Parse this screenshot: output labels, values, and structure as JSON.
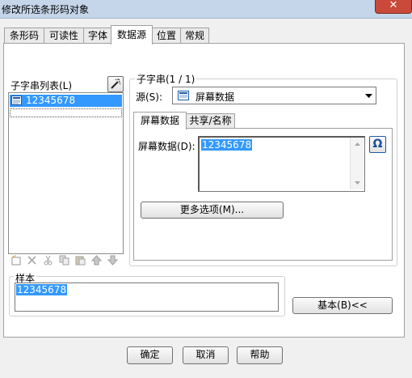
{
  "window": {
    "title": "修改所选条形码对象",
    "close_glyph": "✕"
  },
  "tabs": [
    {
      "label": "条形码"
    },
    {
      "label": "可读性"
    },
    {
      "label": "字体"
    },
    {
      "label": "数据源"
    },
    {
      "label": "位置"
    },
    {
      "label": "常规"
    }
  ],
  "substring_list": {
    "label": "子字串列表(L)",
    "items": [
      "12345678"
    ]
  },
  "substring": {
    "group_label": "子字串(1 / 1)",
    "source_label": "源(S):",
    "source_value": "屏幕数据",
    "subtabs": [
      {
        "label": "屏幕数据"
      },
      {
        "label": "共享/名称"
      }
    ],
    "screen_data_label": "屏幕数据(D):",
    "screen_data_value": "12345678",
    "more_options_label": "更多选项(M)...",
    "omega_glyph": "Ω"
  },
  "sample": {
    "label": "样本",
    "value": "12345678"
  },
  "basic_button": "基本(B)<<",
  "footer": {
    "ok": "确定",
    "cancel": "取消",
    "help": "帮助"
  },
  "colors": {
    "selection": "#3399ff",
    "close_button": "#c94a3a",
    "titlebar": "#c6d6ea"
  }
}
